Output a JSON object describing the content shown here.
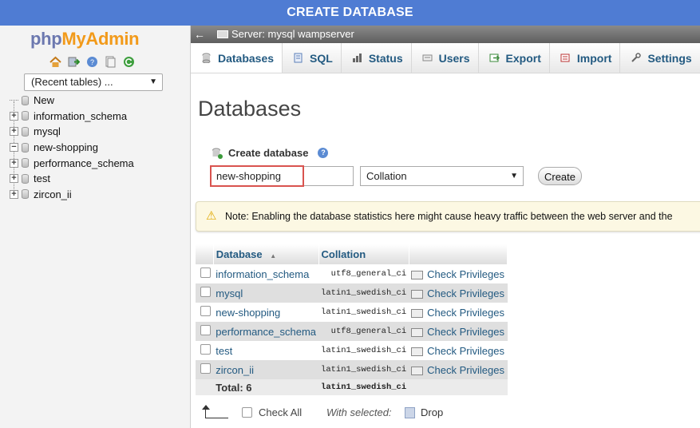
{
  "banner": {
    "title": "CREATE DATABASE"
  },
  "logo": {
    "php": "php",
    "admin": "MyAdmin"
  },
  "nav": {
    "quick_icons": [
      "home-icon",
      "logout-icon",
      "help-icon",
      "docs-icon",
      "reload-icon"
    ],
    "recent_tables": "(Recent tables) ...",
    "tree": [
      {
        "label": "New",
        "toggle": ""
      },
      {
        "label": "information_schema",
        "toggle": "+"
      },
      {
        "label": "mysql",
        "toggle": "+"
      },
      {
        "label": "new-shopping",
        "toggle": "−"
      },
      {
        "label": "performance_schema",
        "toggle": "+"
      },
      {
        "label": "test",
        "toggle": "+"
      },
      {
        "label": "zircon_ii",
        "toggle": "+"
      }
    ]
  },
  "server_bar": {
    "back": "←",
    "text": "Server: mysql wampserver"
  },
  "tabs": [
    {
      "label": "Databases",
      "icon": "database-icon",
      "active": true
    },
    {
      "label": "SQL",
      "icon": "sql-icon"
    },
    {
      "label": "Status",
      "icon": "status-icon"
    },
    {
      "label": "Users",
      "icon": "users-icon"
    },
    {
      "label": "Export",
      "icon": "export-icon"
    },
    {
      "label": "Import",
      "icon": "import-icon"
    },
    {
      "label": "Settings",
      "icon": "settings-icon"
    }
  ],
  "page": {
    "title": "Databases",
    "create_label": "Create database",
    "db_name_value": "new-shopping",
    "collation_value": "Collation",
    "create_button": "Create",
    "notice": "Note: Enabling the database statistics here might cause heavy traffic between the web server and the"
  },
  "table": {
    "headers": {
      "database": "Database",
      "sort_arrow": "▲",
      "collation": "Collation"
    },
    "rows": [
      {
        "name": "information_schema",
        "collation": "utf8_general_ci",
        "action": "Check Privileges"
      },
      {
        "name": "mysql",
        "collation": "latin1_swedish_ci",
        "action": "Check Privileges"
      },
      {
        "name": "new-shopping",
        "collation": "latin1_swedish_ci",
        "action": "Check Privileges"
      },
      {
        "name": "performance_schema",
        "collation": "utf8_general_ci",
        "action": "Check Privileges"
      },
      {
        "name": "test",
        "collation": "latin1_swedish_ci",
        "action": "Check Privileges"
      },
      {
        "name": "zircon_ii",
        "collation": "latin1_swedish_ci",
        "action": "Check Privileges"
      }
    ],
    "total_label": "Total: 6",
    "total_collation": "latin1_swedish_ci"
  },
  "footer": {
    "check_all": "Check All",
    "with_selected": "With selected:",
    "drop": "Drop"
  },
  "colors": {
    "banner": "#4f7cd3",
    "link": "#235a81",
    "highlight": "#d9534f",
    "notice_bg": "#fcf8e3"
  }
}
